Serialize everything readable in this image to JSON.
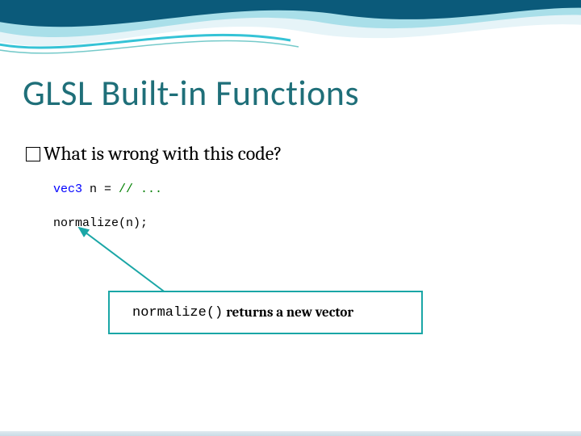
{
  "title": "GLSL Built-in Functions",
  "bullet": "What is wrong with this code?",
  "code": {
    "line1_kw": "vec3",
    "line1_rest": " n = ",
    "line1_comment": "// ...",
    "line2": "normalize(n);"
  },
  "callout": {
    "mono": "normalize()",
    "text": " returns a new vector"
  },
  "colors": {
    "accent": "#1f6f79",
    "box_border": "#1aa6a6",
    "keyword": "#0000ff",
    "comment": "#008000",
    "wave_dark": "#0b5a7a",
    "wave_light": "#35c3d6"
  }
}
